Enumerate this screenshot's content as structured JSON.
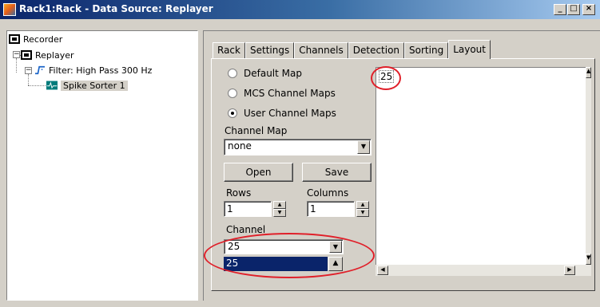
{
  "window": {
    "title": "Rack1:Rack - Data Source: Replayer"
  },
  "tree": {
    "items": [
      {
        "label": "Recorder"
      },
      {
        "label": "Replayer"
      },
      {
        "label": "Filter: High Pass 300 Hz"
      },
      {
        "label": "Spike Sorter 1"
      }
    ]
  },
  "tabs": [
    "Rack",
    "Settings",
    "Channels",
    "Detection",
    "Sorting",
    "Layout"
  ],
  "active_tab": "Layout",
  "map_options": [
    {
      "label": "Default Map",
      "checked": false
    },
    {
      "label": "MCS Channel Maps",
      "checked": false
    },
    {
      "label": "User Channel Maps",
      "checked": true
    }
  ],
  "channel_map": {
    "label": "Channel Map",
    "value": "none"
  },
  "buttons": {
    "open": "Open",
    "save": "Save"
  },
  "rows": {
    "label": "Rows",
    "value": "1"
  },
  "columns": {
    "label": "Columns",
    "value": "1"
  },
  "channel": {
    "label": "Channel",
    "value": "25",
    "list_value": "25"
  },
  "layout_grid": {
    "cell_label": "25"
  },
  "colors": {
    "titlebar": "#0a246a",
    "highlight": "#0a246a",
    "annotation": "#e0202a"
  }
}
